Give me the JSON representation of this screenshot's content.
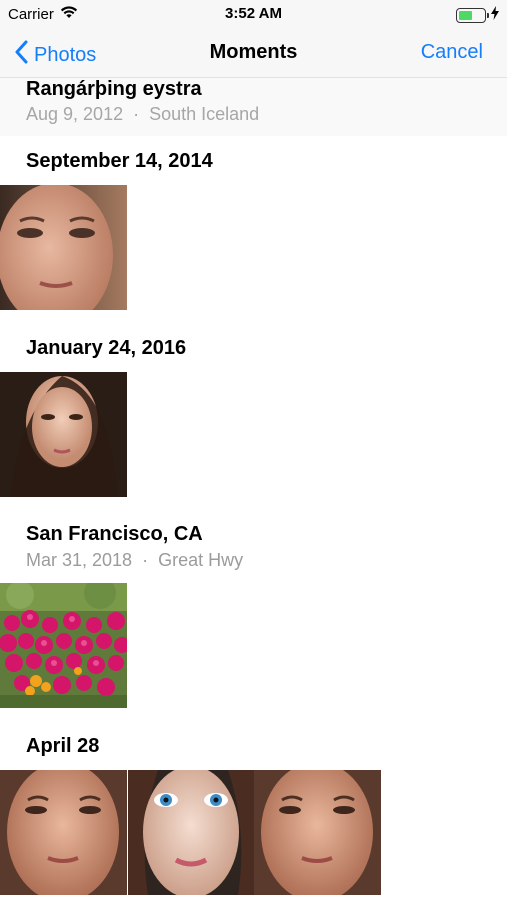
{
  "status_bar": {
    "carrier": "Carrier",
    "time": "3:52 AM"
  },
  "nav": {
    "back_label": "Photos",
    "title": "Moments",
    "cancel_label": "Cancel"
  },
  "moments": [
    {
      "title": "Rangárþing eystra",
      "date": "Aug 9, 2012",
      "place": "South Iceland",
      "photos": []
    },
    {
      "title": "September 14, 2014",
      "photos": [
        "portrait-freckles-woman"
      ]
    },
    {
      "title": "January 24, 2016",
      "photos": [
        "portrait-dark-hair-woman"
      ]
    },
    {
      "title": "San Francisco, CA",
      "date": "Mar 31, 2018",
      "place": "Great Hwy",
      "photos": [
        "magenta-flowers"
      ]
    },
    {
      "title": "April 28",
      "photos": [
        "portrait-freckles-1",
        "portrait-blue-eyes",
        "portrait-freckles-2"
      ]
    }
  ],
  "colors": {
    "accent": "#147efb",
    "battery": "#4cd964",
    "secondary_text": "#9b9b9b"
  }
}
